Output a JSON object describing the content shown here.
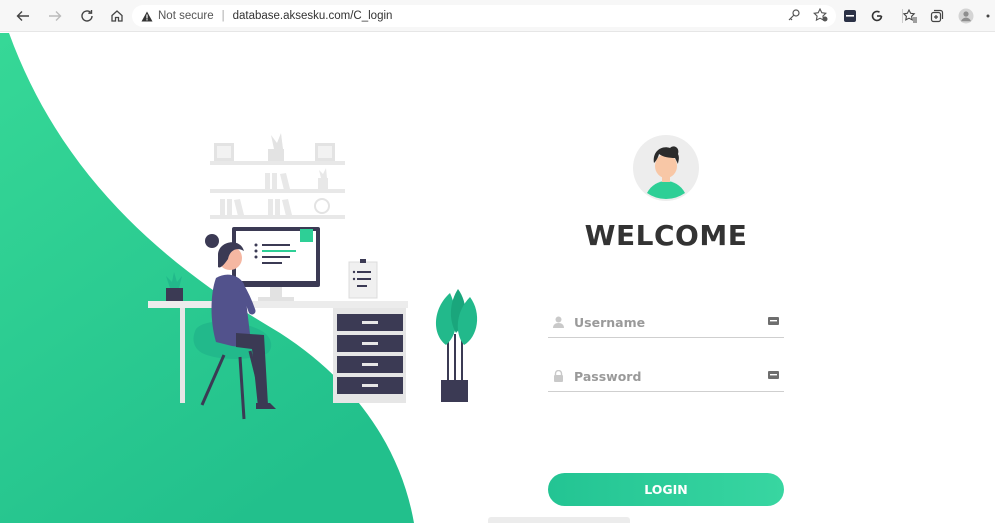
{
  "browser": {
    "security_label": "Not secure",
    "url": "database.aksesku.com/C_login",
    "icons": [
      "back-icon",
      "forward-icon",
      "reload-icon",
      "home-icon",
      "warning-icon",
      "key-icon",
      "favorite-add-icon",
      "extension-icon",
      "refresh-extension-icon",
      "favorites-icon",
      "collections-icon",
      "profile-icon",
      "more-icon"
    ]
  },
  "login": {
    "title": "WELCOME",
    "username_placeholder": "Username",
    "password_placeholder": "Password",
    "button_label": "LOGIN"
  },
  "colors": {
    "brand_green": "#2ecf96",
    "text_dark": "#333333",
    "muted": "#9a9a9a"
  }
}
